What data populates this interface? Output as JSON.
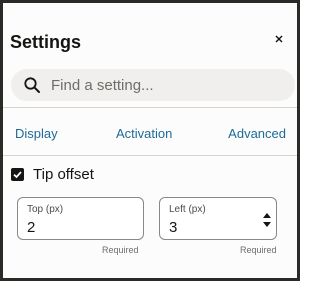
{
  "header": {
    "title": "Settings",
    "close_icon": "close-icon"
  },
  "search": {
    "placeholder": "Find a setting...",
    "icon": "search-icon"
  },
  "tabs": [
    {
      "label": "Display"
    },
    {
      "label": "Activation"
    },
    {
      "label": "Advanced"
    }
  ],
  "tip_offset": {
    "label": "Tip offset",
    "checked": true,
    "fields": [
      {
        "label": "Top (px)",
        "value": "2",
        "helper": "Required"
      },
      {
        "label": "Left (px)",
        "value": "3",
        "helper": "Required"
      }
    ]
  },
  "colors": {
    "accent": "#1d6b96",
    "text": "#161513",
    "search_bg": "#f1efed",
    "divider": "#d6d3cf"
  }
}
